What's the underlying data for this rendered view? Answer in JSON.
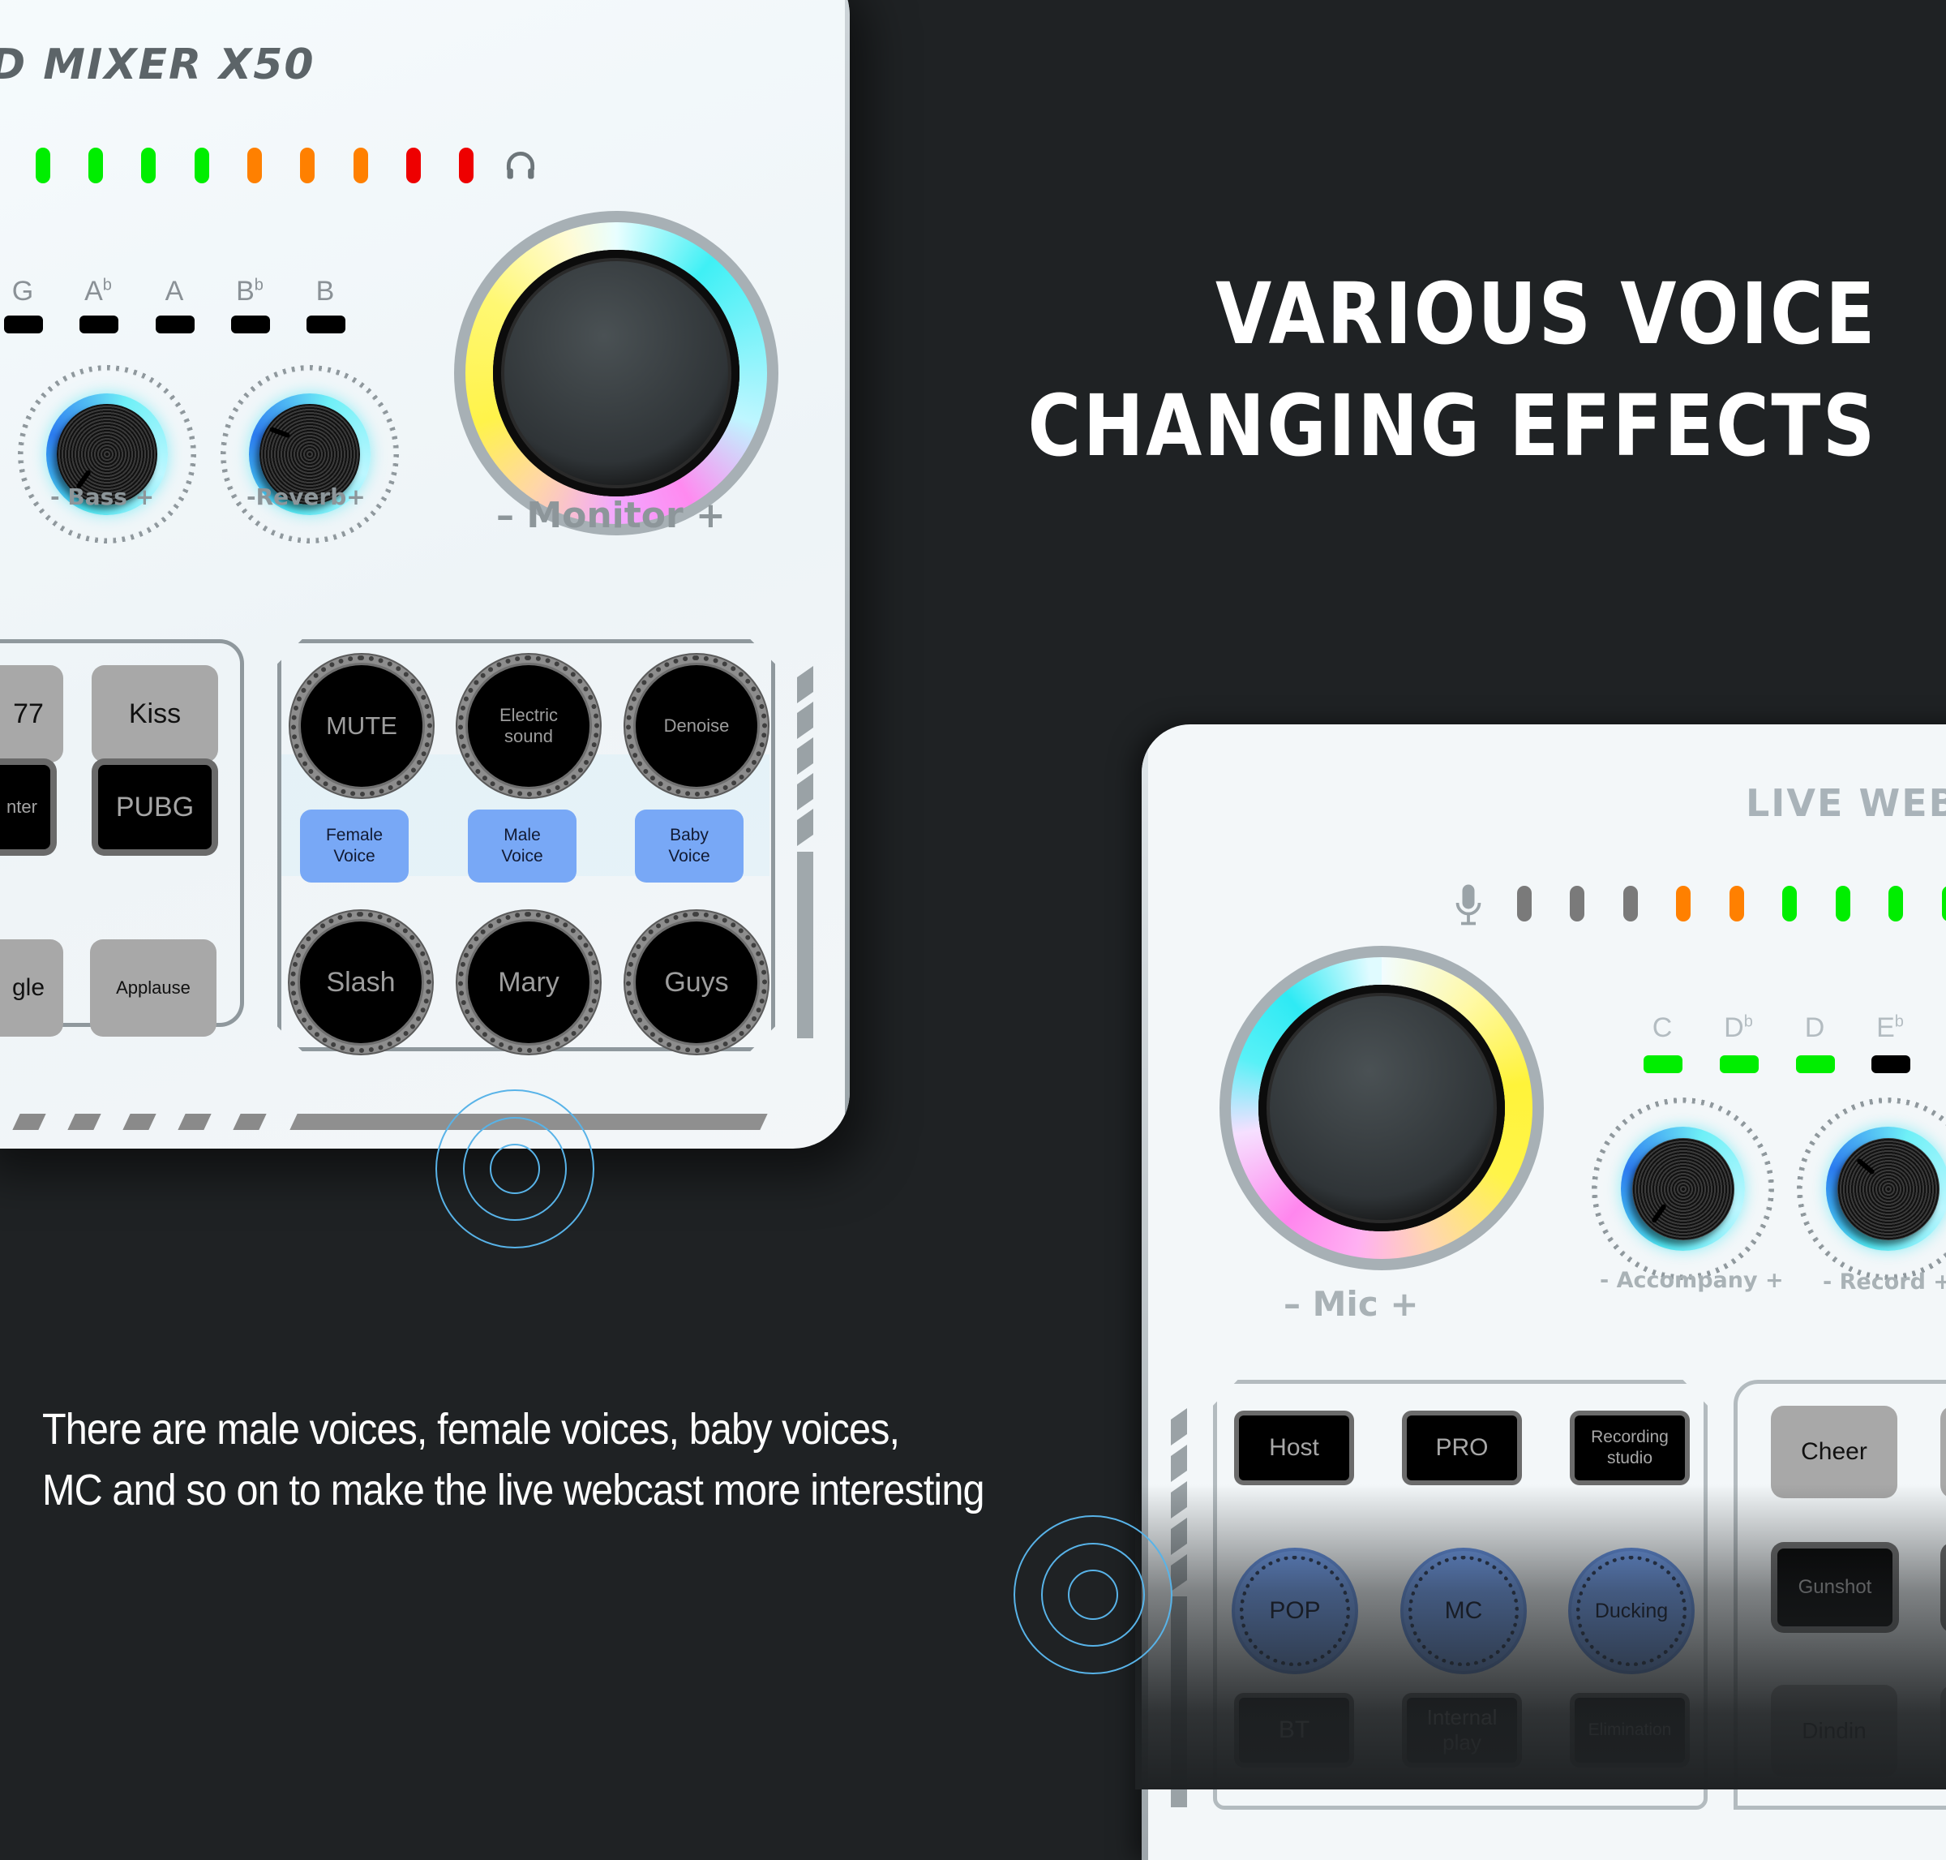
{
  "headline": {
    "line1": "VARIOUS VOICE",
    "line2": "CHANGING EFFECTS"
  },
  "body_copy": {
    "line1": "There are male voices, female voices, baby voices,",
    "line2": "MC and so on to make the live webcast more interesting"
  },
  "colors": {
    "background": "#1f2224",
    "led_green": "#00ee00",
    "led_orange": "#ff8000",
    "led_red": "#ee0000",
    "led_off": "#7a7a7a",
    "pad_blue": "#78a8f6",
    "ping_blue": "#58b3e8"
  },
  "left_device": {
    "brand": "D MIXER X50",
    "level_meter": {
      "leds": [
        "green",
        "green",
        "green",
        "green",
        "orange",
        "orange",
        "orange",
        "red",
        "red"
      ],
      "icon": "headphones-icon"
    },
    "key_notes": [
      "G",
      "Ab",
      "A",
      "Bb",
      "B"
    ],
    "key_notes_display": [
      {
        "base": "G",
        "flat": ""
      },
      {
        "base": "A",
        "flat": "b"
      },
      {
        "base": "A",
        "flat": ""
      },
      {
        "base": "B",
        "flat": "b"
      },
      {
        "base": "B",
        "flat": ""
      }
    ],
    "knobs": {
      "bass": "-  Bass  +",
      "reverb": "-Reverb+",
      "monitor": "–  Monitor  +"
    },
    "sound_pads": [
      {
        "label": "77",
        "style": "grey"
      },
      {
        "label": "Kiss",
        "style": "grey"
      },
      {
        "label": "nter",
        "style": "black"
      },
      {
        "label": "PUBG",
        "style": "black"
      },
      {
        "label": "gle",
        "style": "grey"
      },
      {
        "label": "Applause",
        "style": "grey"
      }
    ],
    "effect_pads": {
      "row1": [
        "MUTE",
        "Electric sound",
        "Denoise"
      ],
      "row2": [
        "Female Voice",
        "Male Voice",
        "Baby Voice"
      ],
      "row3": [
        "Slash",
        "Mary",
        "Guys"
      ]
    }
  },
  "right_device": {
    "brand": "LIVE WEBC",
    "level_meter": {
      "icon": "microphone-icon",
      "leds": [
        "off",
        "off",
        "off",
        "orange",
        "orange",
        "green",
        "green",
        "green",
        "green"
      ]
    },
    "key_notes_display": [
      {
        "base": "C",
        "flat": "",
        "state": "green"
      },
      {
        "base": "D",
        "flat": "b",
        "state": "green"
      },
      {
        "base": "D",
        "flat": "",
        "state": "green"
      },
      {
        "base": "E",
        "flat": "b",
        "state": "off"
      }
    ],
    "knobs": {
      "mic": "–   Mic   +",
      "accompany": "- Accompany +",
      "record": "- Record +"
    },
    "mode_pads": {
      "row1": [
        "Host",
        "PRO",
        "Recording studio"
      ],
      "row2": [
        "POP",
        "MC",
        "Ducking"
      ],
      "row3": [
        "BT",
        "Internal play",
        "Elimination"
      ]
    },
    "sound_pads": [
      "Cheer",
      "Gunshot",
      "Dindin"
    ]
  }
}
